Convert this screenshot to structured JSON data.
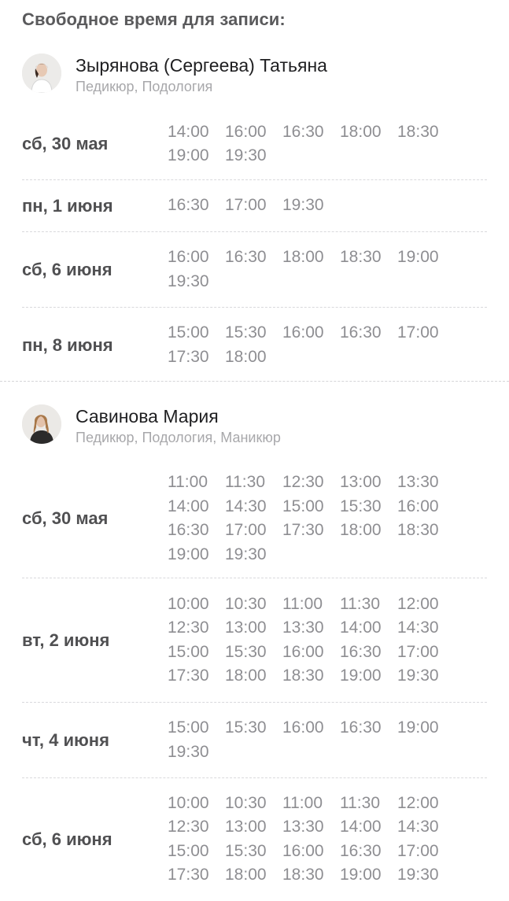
{
  "title": "Свободное время для записи:",
  "specialists": [
    {
      "name": "Зырянова (Сергеева) Татьяна",
      "services": "Педикюр, Подология",
      "avatar_icon": "person-photo-icon",
      "days": [
        {
          "label": "сб, 30 мая",
          "slots": [
            "14:00",
            "16:00",
            "16:30",
            "18:00",
            "18:30",
            "19:00",
            "19:30"
          ]
        },
        {
          "label": "пн, 1 июня",
          "slots": [
            "16:30",
            "17:00",
            "19:30"
          ]
        },
        {
          "label": "сб, 6 июня",
          "slots": [
            "16:00",
            "16:30",
            "18:00",
            "18:30",
            "19:00",
            "19:30"
          ]
        },
        {
          "label": "пн, 8 июня",
          "slots": [
            "15:00",
            "15:30",
            "16:00",
            "16:30",
            "17:00",
            "17:30",
            "18:00"
          ]
        }
      ]
    },
    {
      "name": "Савинова Мария",
      "services": "Педикюр, Подология, Маникюр",
      "avatar_icon": "person-photo-icon",
      "days": [
        {
          "label": "сб, 30 мая",
          "slots": [
            "11:00",
            "11:30",
            "12:30",
            "13:00",
            "13:30",
            "14:00",
            "14:30",
            "15:00",
            "15:30",
            "16:00",
            "16:30",
            "17:00",
            "17:30",
            "18:00",
            "18:30",
            "19:00",
            "19:30"
          ]
        },
        {
          "label": "вт, 2 июня",
          "slots": [
            "10:00",
            "10:30",
            "11:00",
            "11:30",
            "12:00",
            "12:30",
            "13:00",
            "13:30",
            "14:00",
            "14:30",
            "15:00",
            "15:30",
            "16:00",
            "16:30",
            "17:00",
            "17:30",
            "18:00",
            "18:30",
            "19:00",
            "19:30"
          ]
        },
        {
          "label": "чт, 4 июня",
          "slots": [
            "15:00",
            "15:30",
            "16:00",
            "16:30",
            "19:00",
            "19:30"
          ]
        },
        {
          "label": "сб, 6 июня",
          "slots": [
            "10:00",
            "10:30",
            "11:00",
            "11:30",
            "12:00",
            "12:30",
            "13:00",
            "13:30",
            "14:00",
            "14:30",
            "15:00",
            "15:30",
            "16:00",
            "16:30",
            "17:00",
            "17:30",
            "18:00",
            "18:30",
            "19:00",
            "19:30"
          ]
        }
      ]
    }
  ]
}
